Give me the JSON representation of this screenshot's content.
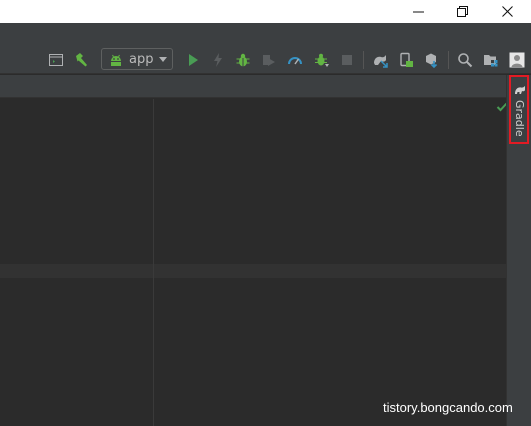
{
  "toolbar": {
    "run_config": {
      "label": "app",
      "icon": "android-icon"
    }
  },
  "sidebar": {
    "gradle_tab": {
      "label": "Gradle",
      "icon": "elephant-icon"
    }
  },
  "watermark": {
    "text": "tistory.bongcando.com"
  },
  "colors": {
    "highlight_box": "#e21b24",
    "run_green": "#499c54",
    "debug_green": "#62b543",
    "blue_icon": "#3592c4",
    "editor_bg": "#2b2b2b",
    "panel_bg": "#3c3f41"
  }
}
